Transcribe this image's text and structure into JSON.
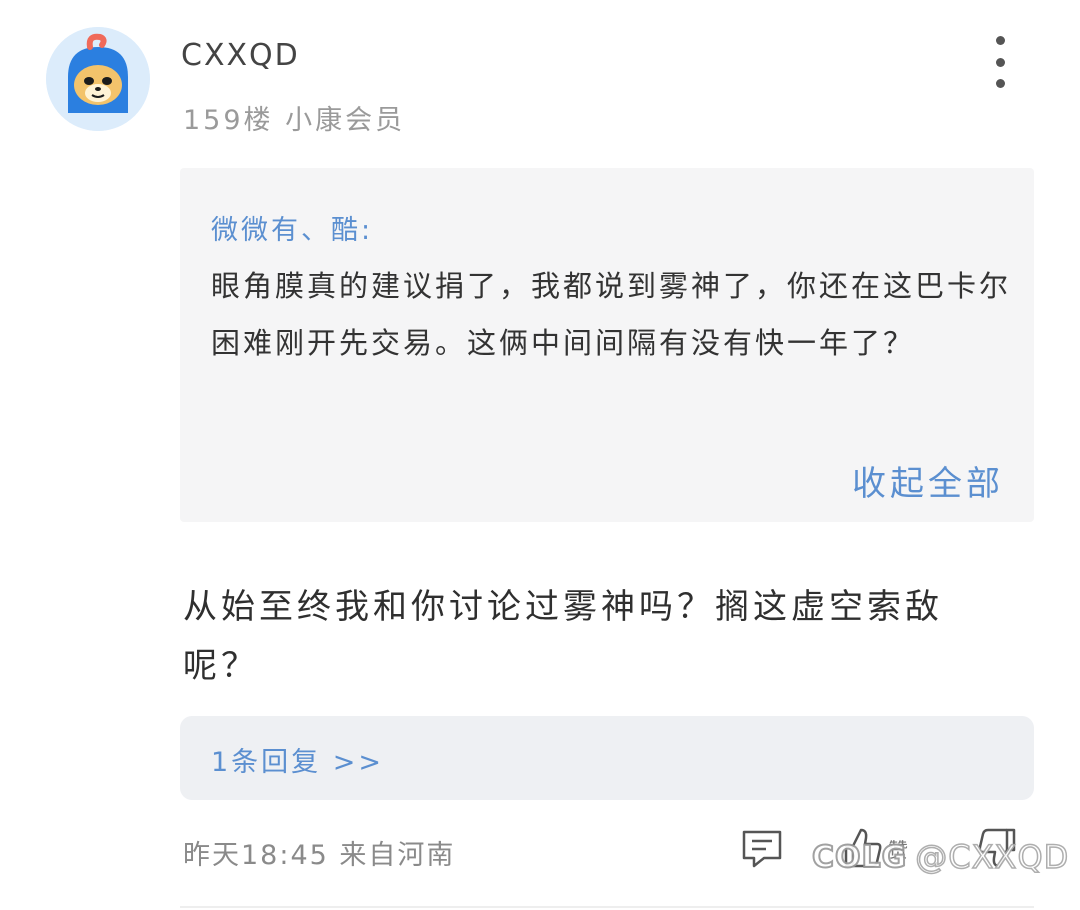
{
  "post": {
    "username": "CXXQD",
    "meta": "159楼 小康会员",
    "quote": {
      "author": "微微有、酷:",
      "text": "眼角膜真的建议捐了，我都说到雾神了，你还在这巴卡尔困难刚开先交易。这俩中间间隔有没有快一年了？",
      "collapse_label": "收起全部"
    },
    "content": "从始至终我和你讨论过雾神吗？搁这虚空索敌呢？",
    "reply_link": "1条回复 >>",
    "timestamp_location": "昨天18:45 来自河南",
    "like_label": "赞"
  },
  "watermark": {
    "logo": "COLG",
    "handle": "@CXXQD"
  },
  "icons": {
    "avatar": "blue-hooded-dog-avatar",
    "more": "more-vertical-icon",
    "comment": "comment-icon",
    "like": "thumbs-up-icon",
    "dislike": "thumbs-down-icon"
  },
  "colors": {
    "accent": "#5b8fd0",
    "quote_bg": "#f5f5f6",
    "reply_bg": "#eef0f3",
    "meta_gray": "#9a9a9a"
  }
}
